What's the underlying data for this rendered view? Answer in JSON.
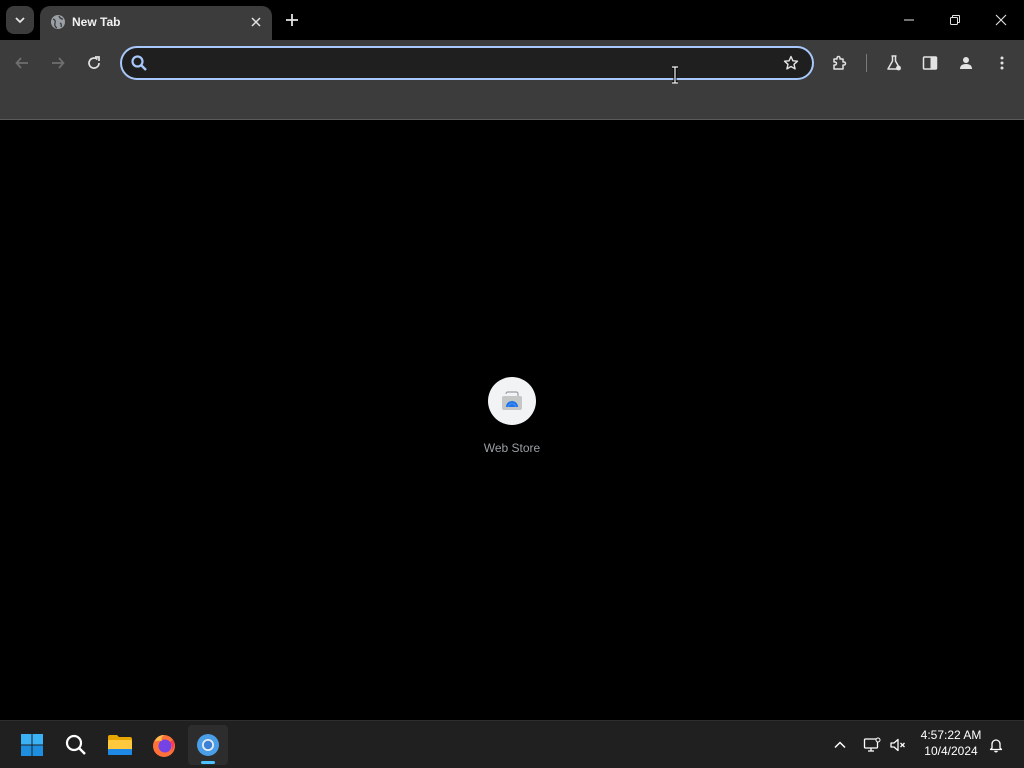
{
  "tabstrip": {
    "active_tab": {
      "title": "New Tab",
      "favicon": "globe-icon"
    },
    "icons": {
      "tab_search": "chevron-down-icon",
      "new_tab": "plus-icon",
      "close_tab": "close-icon",
      "minimize": "minimize-icon",
      "restore": "restore-icon",
      "close_window": "close-icon"
    }
  },
  "toolbar": {
    "omnibox": {
      "value": "",
      "placeholder": ""
    },
    "icons": [
      "back-arrow-icon",
      "forward-arrow-icon",
      "reload-icon",
      "search-icon",
      "star-icon",
      "puzzle-icon",
      "flask-icon",
      "side-panel-icon",
      "person-icon",
      "kebab-menu-icon"
    ]
  },
  "content": {
    "shortcuts": [
      {
        "label": "Web Store",
        "icon": "webstore-icon"
      }
    ]
  },
  "taskbar": {
    "apps": [
      "windows-start-icon",
      "search-icon",
      "file-explorer-icon",
      "firefox-icon",
      "chrome-icon"
    ],
    "active_app": "chrome",
    "tray": {
      "time": "4:57:22 AM",
      "date": "10/4/2024"
    }
  },
  "colors": {
    "toolbar_bg": "#3c3c3c",
    "omnibox_border": "#a8c7fa",
    "page_bg": "#000000",
    "taskbar_bg": "#202020",
    "accent": "#4cc2ff"
  }
}
